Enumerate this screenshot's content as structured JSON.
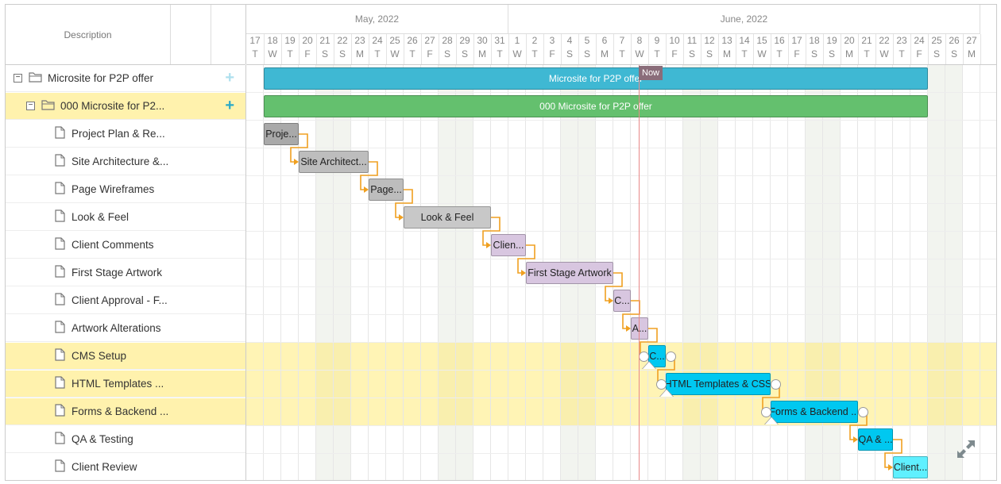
{
  "grid": {
    "description_header": "Description",
    "rows": [
      {
        "label": "Microsite for P2P offer",
        "type": "project"
      },
      {
        "label": "000 Microsite for P2...",
        "type": "folder"
      },
      {
        "label": "Project Plan & Re...",
        "type": "task"
      },
      {
        "label": "Site Architecture &...",
        "type": "task"
      },
      {
        "label": "Page Wireframes",
        "type": "task"
      },
      {
        "label": "Look & Feel",
        "type": "task"
      },
      {
        "label": "Client Comments",
        "type": "task"
      },
      {
        "label": "First Stage Artwork",
        "type": "task"
      },
      {
        "label": "Client Approval - F...",
        "type": "task"
      },
      {
        "label": "Artwork Alterations",
        "type": "task"
      },
      {
        "label": "CMS Setup",
        "type": "task"
      },
      {
        "label": "HTML Templates ...",
        "type": "task"
      },
      {
        "label": "Forms & Backend ...",
        "type": "task"
      },
      {
        "label": "QA & Testing",
        "type": "task"
      },
      {
        "label": "Client Review",
        "type": "task"
      }
    ],
    "expander_minus": "−",
    "add_symbol": "+"
  },
  "timeline": {
    "months": [
      {
        "label": "May, 2022"
      },
      {
        "label": "June, 2022"
      }
    ],
    "days": [
      [
        "17",
        "T"
      ],
      [
        "18",
        "W"
      ],
      [
        "19",
        "T"
      ],
      [
        "20",
        "F"
      ],
      [
        "21",
        "S"
      ],
      [
        "22",
        "S"
      ],
      [
        "23",
        "M"
      ],
      [
        "24",
        "T"
      ],
      [
        "25",
        "W"
      ],
      [
        "26",
        "T"
      ],
      [
        "27",
        "F"
      ],
      [
        "28",
        "S"
      ],
      [
        "29",
        "S"
      ],
      [
        "30",
        "M"
      ],
      [
        "31",
        "T"
      ],
      [
        "1",
        "W"
      ],
      [
        "2",
        "T"
      ],
      [
        "3",
        "F"
      ],
      [
        "4",
        "S"
      ],
      [
        "5",
        "S"
      ],
      [
        "6",
        "M"
      ],
      [
        "7",
        "T"
      ],
      [
        "8",
        "W"
      ],
      [
        "9",
        "T"
      ],
      [
        "10",
        "F"
      ],
      [
        "11",
        "S"
      ],
      [
        "12",
        "S"
      ],
      [
        "13",
        "M"
      ],
      [
        "14",
        "T"
      ],
      [
        "15",
        "W"
      ],
      [
        "16",
        "T"
      ],
      [
        "17",
        "F"
      ],
      [
        "18",
        "S"
      ],
      [
        "19",
        "S"
      ],
      [
        "20",
        "M"
      ],
      [
        "21",
        "T"
      ],
      [
        "22",
        "W"
      ],
      [
        "23",
        "T"
      ],
      [
        "24",
        "F"
      ],
      [
        "25",
        "S"
      ],
      [
        "26",
        "S"
      ],
      [
        "27",
        "M"
      ]
    ],
    "now_label": "Now"
  },
  "bars": [
    {
      "row": 0,
      "start": 1,
      "duration": 38,
      "text": "Microsite for P2P offer",
      "color": "#3fb8d3",
      "kind": "summary"
    },
    {
      "row": 1,
      "start": 1,
      "duration": 38,
      "text": "000 Microsite for P2P offer",
      "color": "#64c06e",
      "kind": "summary"
    },
    {
      "row": 2,
      "start": 1,
      "duration": 2,
      "text": "Proje...",
      "color": "#a9a9a9",
      "kind": "task"
    },
    {
      "row": 3,
      "start": 3,
      "duration": 4,
      "text": "Site Architect...",
      "color": "#bdbdbd",
      "kind": "task"
    },
    {
      "row": 4,
      "start": 7,
      "duration": 2,
      "text": "Page...",
      "color": "#bdbdbd",
      "kind": "task"
    },
    {
      "row": 5,
      "start": 9,
      "duration": 5,
      "text": "Look & Feel",
      "color": "#c8c8c8",
      "kind": "task"
    },
    {
      "row": 6,
      "start": 14,
      "duration": 2,
      "text": "Clien...",
      "color": "#d8c6e0",
      "kind": "task"
    },
    {
      "row": 7,
      "start": 16,
      "duration": 5,
      "text": "First Stage Artwork",
      "color": "#d8c6e0",
      "kind": "task"
    },
    {
      "row": 8,
      "start": 21,
      "duration": 1,
      "text": "C...",
      "color": "#d8c6e0",
      "kind": "task"
    },
    {
      "row": 9,
      "start": 22,
      "duration": 1,
      "text": "A...",
      "color": "#d8c6e0",
      "kind": "task"
    },
    {
      "row": 10,
      "start": 23,
      "duration": 1,
      "text": "C...",
      "color": "#00c8f0",
      "kind": "task"
    },
    {
      "row": 11,
      "start": 24,
      "duration": 6,
      "text": "HTML Templates & CSS",
      "color": "#00c8f0",
      "kind": "task"
    },
    {
      "row": 12,
      "start": 30,
      "duration": 5,
      "text": "Forms & Backend ...",
      "color": "#00c8f0",
      "kind": "task"
    },
    {
      "row": 13,
      "start": 35,
      "duration": 2,
      "text": "QA & ...",
      "color": "#00c8f0",
      "kind": "task"
    },
    {
      "row": 14,
      "start": 37,
      "duration": 2,
      "text": "Client...",
      "color": "#5ff0ff",
      "kind": "task"
    }
  ],
  "colors": {
    "selected_row": "#fff2ad",
    "now_line": "#e88888",
    "link": "#f0a020",
    "add_light": "#aee0ee",
    "add_dark": "#2aa9c7"
  },
  "icons": {
    "folder": "folder-icon",
    "document": "document-icon",
    "expand": "expand-arrows-icon"
  }
}
